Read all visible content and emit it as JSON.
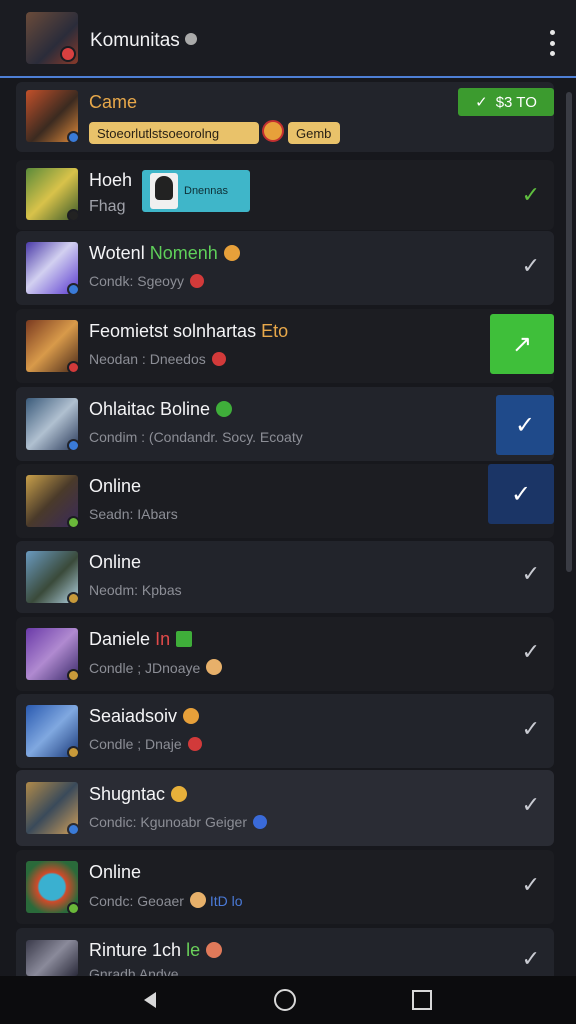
{
  "app": {
    "title": "Komunitas",
    "title_icon": "info-circle-icon",
    "menu_icon": "more-vert-icon"
  },
  "accent": "#4e7fd6",
  "header_row": {
    "name": "Came",
    "action_label": "$3 TO",
    "tag_text": "Stoeorlutlstsoeorolng",
    "tag2_text": "Gemb",
    "emoji": "smiley-emoji"
  },
  "rows": [
    {
      "name": "Hoeh",
      "sub": "Fhag",
      "chip_text": "Dnennas",
      "check": "check-icon"
    },
    {
      "name": "Wotenl",
      "name_accent": "Nomenh",
      "sub": "Condk: Sgeoyy",
      "check": "check-icon"
    },
    {
      "name": "Feomietst solnhartas",
      "name_accent": "Eto",
      "sub": "Neodan : Dneedos",
      "action": "arrow-icon"
    },
    {
      "name": "Ohlaitac Boline",
      "sub": "Condim : (Condandr. Socy. Ecoaty",
      "action": "check-icon"
    },
    {
      "name": "Online",
      "sub": "Seadn: IAbars",
      "action": "check-icon"
    },
    {
      "name": "Online",
      "sub": "Neodm: Kpbas",
      "check": "check-icon"
    },
    {
      "name": "Daniele",
      "name_accent": "In",
      "sub": "Condle ; JDnoaye",
      "check": "check-icon"
    },
    {
      "name": "Seaiadsoiv",
      "sub": "Condle ; Dnaje",
      "check": "check-icon"
    },
    {
      "name": "Shugntac",
      "sub": "Condic: Kgunoabr Geiger",
      "check": "check-icon"
    },
    {
      "name": "Online",
      "sub": "Condc: Geoaer",
      "sub_accent": "ItD lo",
      "check": "check-icon"
    },
    {
      "name": "Rinture 1ch",
      "name_accent": "le",
      "sub": "Gnradh Andve",
      "check": "check-icon"
    }
  ],
  "nav": {
    "back": "back-triangle-icon",
    "home": "home-circle-icon",
    "recent": "recents-square-icon"
  }
}
